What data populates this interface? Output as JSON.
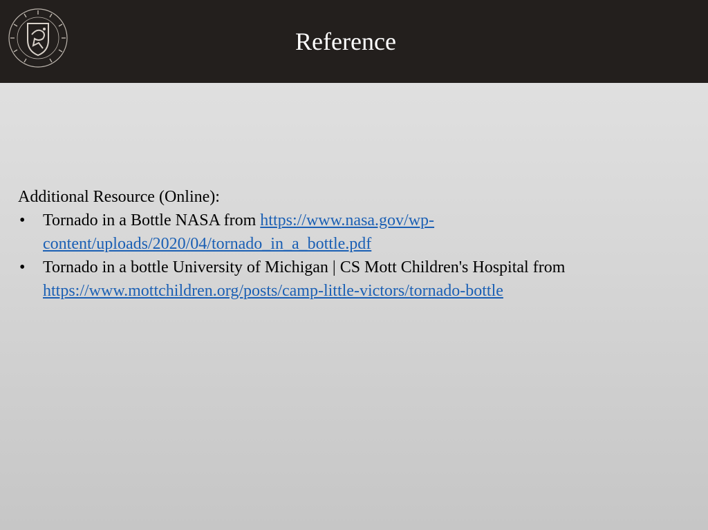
{
  "header": {
    "title": "Reference",
    "logo_icon": "university-crest-logo",
    "background": "#231f1d"
  },
  "content": {
    "heading": "Additional Resource (Online):",
    "bullet_glyph": "•",
    "references": [
      {
        "text": "Tornado in a Bottle NASA from ",
        "link_line1": "https://www.nasa.gov/wp-",
        "link_line2": "content/uploads/2020/04/tornado_in_a_bottle.pdf"
      },
      {
        "text": "Tornado in a bottle University of Michigan | CS Mott Children's Hospital from",
        "link": "https://www.mottchildren.org/posts/camp-little-victors/tornado-bottle"
      }
    ],
    "link_color": "#1a5fb4"
  }
}
